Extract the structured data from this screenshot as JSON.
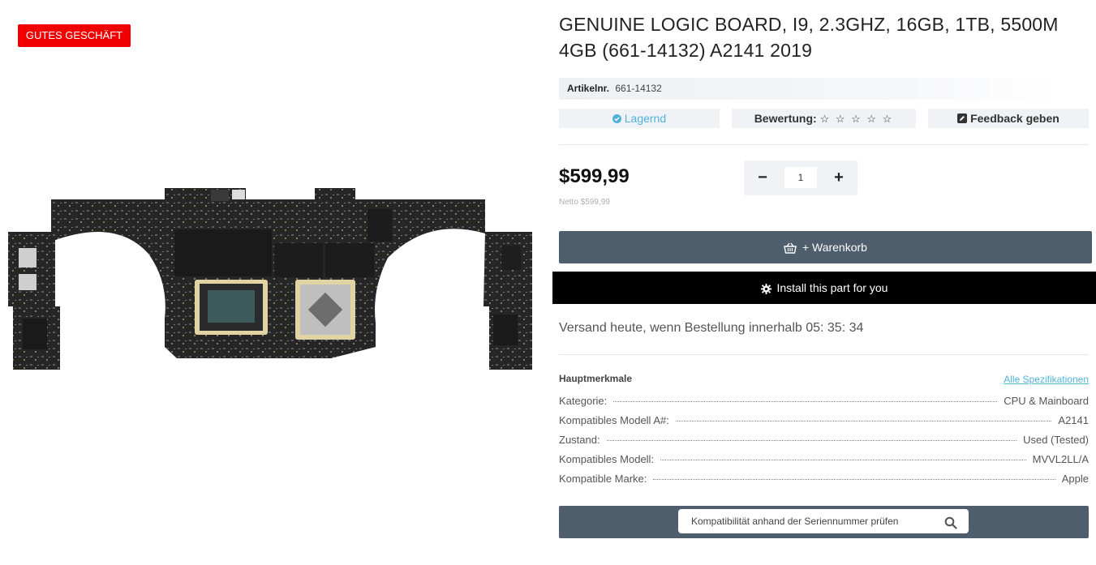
{
  "badge": {
    "label": "GUTES GESCHÄFT",
    "color": "#f00000"
  },
  "product": {
    "title": "GENUINE LOGIC BOARD, I9, 2.3GHZ, 16GB, 1TB, 5500M 4GB (661-14132) A2141 2019",
    "sku_label": "Artikelnr.",
    "sku_value": "661-14132",
    "image_icon": "logic-board-image"
  },
  "meta": {
    "stock": {
      "icon": "check-circle-icon",
      "label": "Lagernd",
      "color": "#4fb2d8"
    },
    "rating": {
      "label": "Bewertung:",
      "stars": "☆ ☆ ☆ ☆ ☆",
      "star_count": 0
    },
    "feedback": {
      "icon": "edit-icon",
      "label": "Feedback geben"
    }
  },
  "pricing": {
    "price": "$599,99",
    "net": "Netto $599,99"
  },
  "quantity": {
    "minus": "−",
    "plus": "+",
    "value": "1"
  },
  "actions": {
    "add_to_cart": "+ Warenkorb",
    "install": "Install this part for you"
  },
  "shipping": {
    "text": "Versand heute, wenn Bestellung innerhalb 05: 35: 34"
  },
  "features": {
    "title": "Hauptmerkmale",
    "all_specs": "Alle Spezifikationen",
    "rows": [
      {
        "label": "Kategorie:",
        "value": "CPU & Mainboard"
      },
      {
        "label": "Kompatibles Modell A#:",
        "value": "A2141"
      },
      {
        "label": "Zustand:",
        "value": "Used (Tested)"
      },
      {
        "label": "Kompatibles Modell:",
        "value": "MVVL2LL/A"
      },
      {
        "label": "Kompatible Marke:",
        "value": "Apple"
      }
    ]
  },
  "serial_check": {
    "placeholder": "Kompatibilität anhand der Seriennummer prüfen",
    "icon": "search-icon"
  },
  "colors": {
    "primary_button": "#4e5e6c",
    "link": "#4fb2d8",
    "install_button": "#000000"
  }
}
